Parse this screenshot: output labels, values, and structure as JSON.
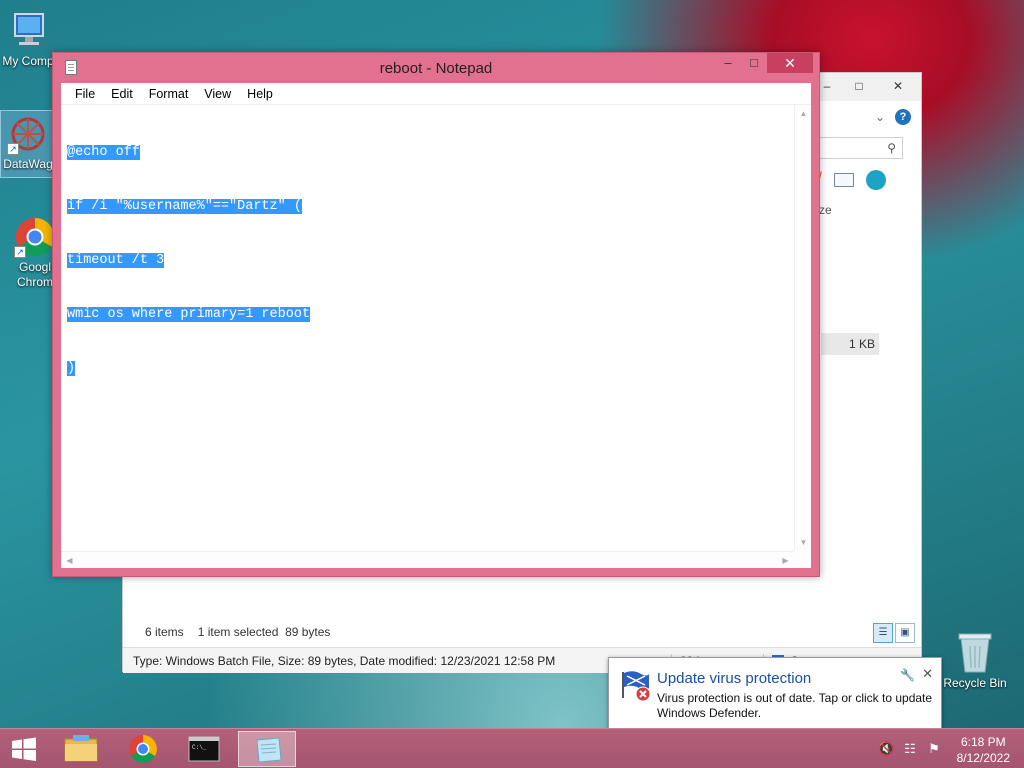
{
  "desktop": {
    "icons": [
      {
        "label": "My Comp"
      },
      {
        "label": "DataWag"
      },
      {
        "label": "Googl Chrom"
      }
    ],
    "recycle_bin": "Recycle Bin"
  },
  "explorer": {
    "size_col": "ze",
    "kb_value": "1 KB",
    "item_count": "6 items",
    "selection": "1 item selected  89 bytes",
    "details": "Type: Windows Batch File, Size: 89 bytes, Date modified: 12/23/2021 12:58 PM",
    "details_size": "89 bytes",
    "details_location": "Computer"
  },
  "notepad": {
    "title": "reboot - Notepad",
    "menu": [
      "File",
      "Edit",
      "Format",
      "View",
      "Help"
    ],
    "lines": [
      "@echo off",
      "if /i \"%username%\"==\"Dartz\" (",
      "timeout /t 3",
      "wmic os where primary=1 reboot",
      ")"
    ]
  },
  "notification": {
    "title": "Update virus protection",
    "message": "Virus protection is out of date. Tap or click to update Windows Defender."
  },
  "taskbar": {
    "time": "6:18 PM",
    "date": "8/12/2022"
  }
}
